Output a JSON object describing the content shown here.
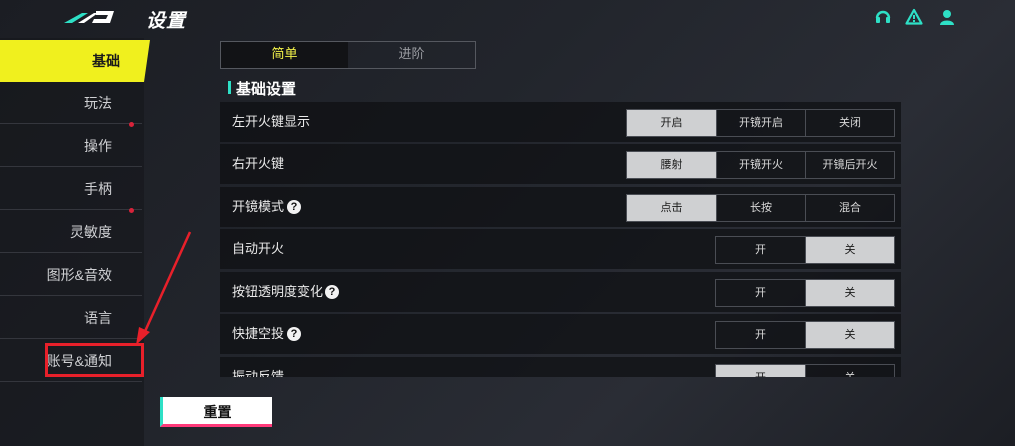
{
  "header": {
    "title": "设置",
    "icons": [
      "headset-icon",
      "warning-icon",
      "user-icon"
    ],
    "accent_color": "#2ee0c6"
  },
  "sidebar": {
    "items": [
      {
        "label": "基础",
        "active": true,
        "dot": false
      },
      {
        "label": "玩法",
        "active": false,
        "dot": false
      },
      {
        "label": "操作",
        "active": false,
        "dot": true
      },
      {
        "label": "手柄",
        "active": false,
        "dot": false
      },
      {
        "label": "灵敏度",
        "active": false,
        "dot": true
      },
      {
        "label": "图形&音效",
        "active": false,
        "dot": false
      },
      {
        "label": "语言",
        "active": false,
        "dot": false
      },
      {
        "label": "账号&通知",
        "active": false,
        "dot": false
      }
    ],
    "active_color": "#f0f01e"
  },
  "tabs": [
    {
      "label": "简单",
      "active": true
    },
    {
      "label": "进阶",
      "active": false
    }
  ],
  "section": {
    "title": "基础设置"
  },
  "settings": [
    {
      "label": "左开火键显示",
      "help": false,
      "options": [
        "开启",
        "开镜开启",
        "关闭"
      ],
      "selected": 0
    },
    {
      "label": "右开火键",
      "help": false,
      "options": [
        "腰射",
        "开镜开火",
        "开镜后开火"
      ],
      "selected": 0
    },
    {
      "label": "开镜模式",
      "help": true,
      "options": [
        "点击",
        "长按",
        "混合"
      ],
      "selected": 0
    },
    {
      "label": "自动开火",
      "help": false,
      "options": [
        "开",
        "关"
      ],
      "selected": 1
    },
    {
      "label": "按钮透明度变化",
      "help": true,
      "options": [
        "开",
        "关"
      ],
      "selected": 1
    },
    {
      "label": "快捷空投",
      "help": true,
      "options": [
        "开",
        "关"
      ],
      "selected": 1
    },
    {
      "label": "振动反馈",
      "help": false,
      "options": [
        "开",
        "关"
      ],
      "selected": 0
    }
  ],
  "footer": {
    "reset_label": "重置"
  },
  "help_glyph": "?"
}
